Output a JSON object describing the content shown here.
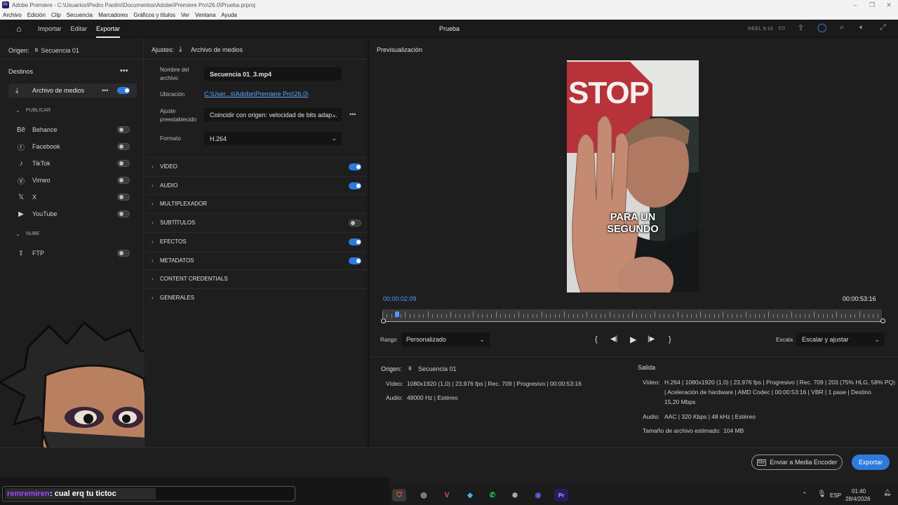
{
  "titlebar": {
    "logo": "Pr",
    "title": "Adobe Premiere - C:\\Usuarios\\Pedro Paolini\\Documentos\\Adobe\\Premiere Pro\\26.0\\Prueba.prproj"
  },
  "menu": [
    "Archivo",
    "Edición",
    "Clip",
    "Secuencia",
    "Marcadores",
    "Gráficos y títulos",
    "Ver",
    "Ventana",
    "Ayuda"
  ],
  "header": {
    "tabs": [
      "Importar",
      "Editar",
      "Exportar"
    ],
    "active_tab": "Exportar",
    "project": "Prueba",
    "reel_label": "REEL 9:16"
  },
  "origin": {
    "label": "Origen:",
    "value": "Secuencia 01"
  },
  "destinations": {
    "title": "Destinos",
    "media_file": {
      "label": "Archivo de medios",
      "enabled": true
    },
    "publish_header": "PUBLICAR",
    "publish": [
      {
        "label": "Behance",
        "icon": "behance-icon",
        "enabled": false
      },
      {
        "label": "Facebook",
        "icon": "facebook-icon",
        "enabled": false
      },
      {
        "label": "TikTok",
        "icon": "tiktok-icon",
        "enabled": false
      },
      {
        "label": "Vimeo",
        "icon": "vimeo-icon",
        "enabled": false
      },
      {
        "label": "X",
        "icon": "x-icon",
        "enabled": false
      },
      {
        "label": "YouTube",
        "icon": "youtube-icon",
        "enabled": false
      }
    ],
    "cloud_header": "NUBE",
    "cloud": [
      {
        "label": "FTP",
        "icon": "upload-icon",
        "enabled": false
      }
    ]
  },
  "settings": {
    "label": "Ajustes:",
    "target": "Archivo de medios",
    "file_name_label_1": "Nombre del",
    "file_name_label_2": "archivo",
    "file_name": "Secuencia 01_3.mp4",
    "location_label": "Ubicación",
    "location": "C:\\User...s\\Adobe\\Premiere Pro\\26.0\\",
    "preset_label_1": "Ajuste",
    "preset_label_2": "preestablecido",
    "preset": "Coincidir con origen: velocidad de bits adap...",
    "format_label": "Formato",
    "format": "H.264",
    "sections": [
      {
        "label": "VÍDEO",
        "toggle": true,
        "enabled": true
      },
      {
        "label": "AUDIO",
        "toggle": true,
        "enabled": true
      },
      {
        "label": "MULTIPLEXADOR",
        "toggle": false,
        "enabled": false
      },
      {
        "label": "SUBTÍTULOS",
        "toggle": true,
        "enabled": false
      },
      {
        "label": "EFECTOS",
        "toggle": true,
        "enabled": true
      },
      {
        "label": "METADATOS",
        "toggle": true,
        "enabled": true
      },
      {
        "label": "CONTENT CREDENTIALS",
        "toggle": false,
        "enabled": false
      },
      {
        "label": "GENERALES",
        "toggle": false,
        "enabled": false
      }
    ]
  },
  "preview": {
    "title": "Previsualización",
    "stop_sign_text": "STOP",
    "caption_line_1": "PARA UN",
    "caption_line_2": "SEGUNDO",
    "current_time": "00:00:02:09",
    "duration": "00:00:53:16",
    "playhead_fraction": 0.025,
    "range_label": "Rango",
    "range_value": "Personalizado",
    "scale_label": "Escala",
    "scale_value": "Escalar y ajustar"
  },
  "summary": {
    "origin_label": "Origen:",
    "origin_value": "Secuencia 01",
    "origin_video_label": "Vídeo:",
    "origin_video": "1080x1920 (1,0)  |  23,976 fps  |  Rec. 709  |  Progresivo  |  00:00:53:16",
    "origin_audio_label": "Audio:",
    "origin_audio": "48000 Hz  |  Estéreo",
    "output_label": "Salida",
    "output_video_label": "Vídeo:",
    "output_video_1": "H.264  |  1080x1920 (1,0)  |  23,976 fps  |  Progresivo  |  Rec. 709  |  203 (75% HLG, 58% PQ)",
    "output_video_2": "|  Aceleración de hardware  |  AMD Codec  |  00:00:53:16  |  VBR  |  1 pase  |  Destino",
    "output_video_3": "15,20 Mbps",
    "output_audio_label": "Audio:",
    "output_audio": "AAC  |  320 Kbps  |  48 kHz  |  Estéreo",
    "file_size_label": "Tamaño de archivo estimado:",
    "file_size": "104 MB"
  },
  "footer": {
    "encoder_button": "Enviar a Media Encoder",
    "export_button": "Exportar"
  },
  "chat": {
    "user": "remremiren",
    "message": ": cual erq tu tictoc"
  },
  "taskbar": {
    "lang": "ESP",
    "time": "01:40",
    "date": "28/4/2026",
    "pr_label": "Pr"
  },
  "colors": {
    "accent": "#2d7bdc",
    "panel": "#1e1e1e",
    "header": "#1a1a1a"
  }
}
